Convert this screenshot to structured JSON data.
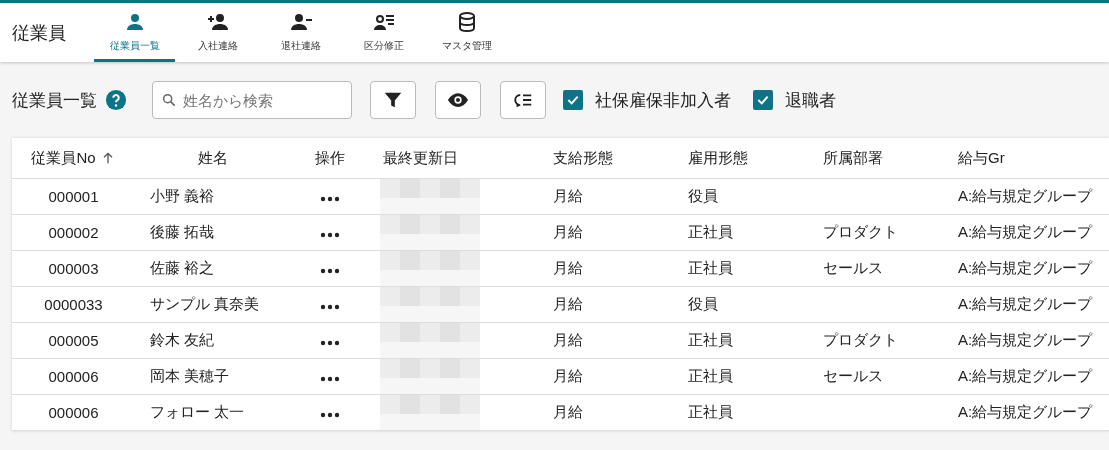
{
  "app": {
    "title": "従業員"
  },
  "nav_tabs": [
    {
      "label": "従業員一覧",
      "kind": "person",
      "selected": true
    },
    {
      "label": "入社連絡",
      "kind": "person-add",
      "selected": false
    },
    {
      "label": "退社連絡",
      "kind": "person-remove",
      "selected": false
    },
    {
      "label": "区分修正",
      "kind": "person-list",
      "selected": false
    },
    {
      "label": "マスタ管理",
      "kind": "database",
      "selected": false
    }
  ],
  "toolbar": {
    "title": "従業員一覧",
    "search": {
      "placeholder": "姓名から検索"
    },
    "buttons": [
      {
        "kind": "filter"
      },
      {
        "kind": "view"
      },
      {
        "kind": "sort-list"
      }
    ],
    "filters": [
      {
        "label": "社保雇保非加入者",
        "checked": true
      },
      {
        "label": "退職者",
        "checked": true
      }
    ]
  },
  "table": {
    "columns": [
      {
        "label": "従業員No",
        "sorted": true
      },
      {
        "label": "姓名"
      },
      {
        "label": "操作"
      },
      {
        "label": "最終更新日"
      },
      {
        "label": "支給形態"
      },
      {
        "label": "雇用形態"
      },
      {
        "label": "所属部署"
      },
      {
        "label": "給与Gr"
      }
    ],
    "rows": [
      {
        "no": "000001",
        "name": "小野 義裕",
        "pay_type": "月給",
        "employment": "役員",
        "salary_group": "A:給与規定グループ"
      },
      {
        "no": "000002",
        "name": "後藤 拓哉",
        "pay_type": "月給",
        "employment": "正社員",
        "department": "プロダクト",
        "salary_group": "A:給与規定グループ"
      },
      {
        "no": "000003",
        "name": "佐藤 裕之",
        "pay_type": "月給",
        "employment": "正社員",
        "department": "セールス",
        "salary_group": "A:給与規定グループ"
      },
      {
        "no": "0000033",
        "name": "サンプル 真奈美",
        "pay_type": "月給",
        "employment": "役員",
        "salary_group": "A:給与規定グループ"
      },
      {
        "no": "000005",
        "name": "鈴木 友紀",
        "pay_type": "月給",
        "employment": "正社員",
        "department": "プロダクト",
        "salary_group": "A:給与規定グループ"
      },
      {
        "no": "000006",
        "name": "岡本 美穂子",
        "pay_type": "月給",
        "employment": "正社員",
        "department": "セールス",
        "salary_group": "A:給与規定グループ"
      },
      {
        "no": "000006",
        "name": "フォロー 太一",
        "pay_type": "月給",
        "employment": "正社員",
        "salary_group": "A:給与規定グループ"
      }
    ]
  }
}
